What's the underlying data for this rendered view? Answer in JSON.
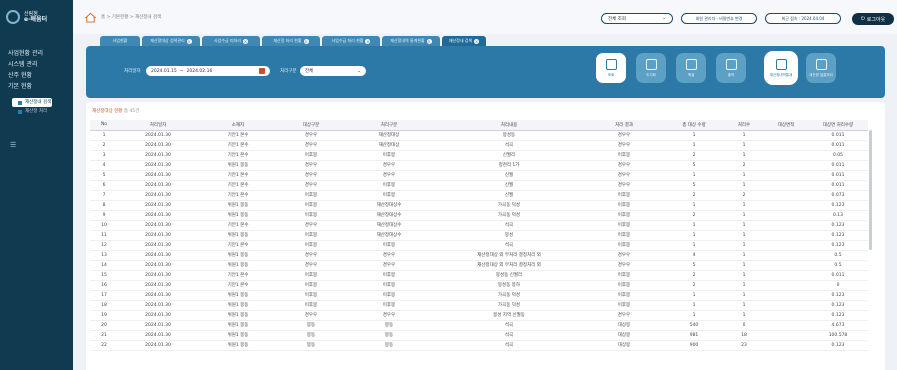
{
  "sidebar": {
    "logo_top": "산림청",
    "logo_name": "e-배움터",
    "items": [
      "사업현황 관리",
      "시스템 관리",
      "산주 현황",
      "기본 현황"
    ],
    "subitems": [
      "재산정내 검색",
      "재산정 처리"
    ]
  },
  "topbar": {
    "breadcrumb": "홈 > 기본현황 > 재산정내 검색",
    "right_label": "관리",
    "select_value": "전체 조회",
    "pill1": "회원 관리자 · 비밀번호 변경",
    "pill2": "최근 접속 : 2024.04.04",
    "logout": "로그아웃"
  },
  "tabs": [
    {
      "label": "사업현황",
      "active": false
    },
    {
      "label": "재산정대상 검색관리",
      "active": false
    },
    {
      "label": "사업수급 미처리",
      "active": false
    },
    {
      "label": "재산정 처리 현황",
      "active": false
    },
    {
      "label": "사업수급 처리 현황",
      "active": false
    },
    {
      "label": "재산정내역 통계현황",
      "active": false
    },
    {
      "label": "재산정내 검색",
      "active": true
    }
  ],
  "filters": {
    "period_label": "처리일자",
    "date_from": "2024.01.15",
    "date_to": "2024.02.16",
    "type_label": "처리구분",
    "type_value": "전체"
  },
  "buttons": [
    "조회",
    "초기화",
    "엑셀",
    "출력",
    "재산정내역통계",
    "재산정 일괄처리"
  ],
  "table": {
    "count_label": "재산정대상 현황",
    "count_value": "총 45건",
    "headers": [
      "No",
      "처리일자",
      "소재지",
      "대상구분",
      "처리구분",
      "처리내용",
      "처리 결과",
      "총 대상 수량",
      "처리수",
      "대상면적",
      "대상면 처리수량"
    ],
    "rows": [
      [
        "1",
        "2024.01.30",
        "기안1 본수",
        "경우우",
        "재산정대상",
        "봉성동",
        "경우우",
        "1",
        "1",
        "",
        "0.011"
      ],
      [
        "2",
        "2024.01.30",
        "기안1 본수",
        "경우우",
        "재산정대상",
        "석곡",
        "경우우",
        "1",
        "1",
        "",
        "0.011"
      ],
      [
        "3",
        "2024.01.30",
        "기안1 본수",
        "이후봉",
        "이후봉",
        "신월리",
        "이후봉",
        "2",
        "1",
        "",
        "0.05"
      ],
      [
        "4",
        "2024.01.30",
        "위원1 봉동",
        "경우우",
        "경우우",
        "청천리 1가",
        "경우우",
        "5",
        "2",
        "",
        "0.011"
      ],
      [
        "5",
        "2024.01.30",
        "기안1 본수",
        "경우우",
        "경우우",
        "신월",
        "경우우",
        "1",
        "1",
        "",
        "0.011"
      ],
      [
        "6",
        "2024.01.30",
        "기안1 본수",
        "경우우",
        "이후봉",
        "신월",
        "경우우",
        "5",
        "1",
        "",
        "0.011"
      ],
      [
        "7",
        "2024.01.30",
        "기안1 본수",
        "이후봉",
        "이후봉",
        "신월",
        "이후봉",
        "2",
        "2",
        "",
        "0.073"
      ],
      [
        "8",
        "2024.01.30",
        "위원1 봉동",
        "이후봉",
        "재산정대상수",
        "가곡동 덕성",
        "이후봉",
        "1",
        "1",
        "",
        "0.123"
      ],
      [
        "9",
        "2024.01.30",
        "위원1 봉동",
        "이후봉",
        "재산정대상수",
        "가곡동 덕성",
        "이후봉",
        "2",
        "1",
        "",
        "0.13"
      ],
      [
        "10",
        "2024.01.30",
        "기안1 본수",
        "경우우",
        "재산정대상수",
        "석곡",
        "이후봉",
        "1",
        "1",
        "",
        "0.123"
      ],
      [
        "11",
        "2024.01.30",
        "위원1 봉동",
        "이후봉",
        "재산정대상수",
        "봉성",
        "이후봉",
        "1",
        "1",
        "",
        "0.123"
      ],
      [
        "12",
        "2024.01.30",
        "기안1 본수",
        "이후봉",
        "이후봉",
        "석곡",
        "이후봉",
        "1",
        "1",
        "",
        "0.123"
      ],
      [
        "13",
        "2024.01.30",
        "위원1 봉동",
        "경우우",
        "경우우",
        "재산정대상 외 무처리 결정처리 외",
        "경우우",
        "4",
        "1",
        "",
        "0.5"
      ],
      [
        "14",
        "2024.01.30",
        "위원1 봉동",
        "경우우",
        "경우우",
        "재산정대상 외 무처리 결정처리 외",
        "경우우",
        "5",
        "1",
        "",
        "0.5"
      ],
      [
        "15",
        "2024.01.30",
        "기안1 본수",
        "이후봉",
        "이후봉",
        "봉성동 신월리",
        "이후봉",
        "2",
        "1",
        "",
        "0.011"
      ],
      [
        "16",
        "2024.01.30",
        "기안1 본수",
        "이후봉",
        "이후봉",
        "봉성동 봉하",
        "이후봉",
        "2",
        "1",
        "",
        "0"
      ],
      [
        "17",
        "2024.01.30",
        "위원1 봉동",
        "이후봉",
        "이후봉",
        "가곡동 덕성",
        "이후봉",
        "1",
        "1",
        "",
        "0.123"
      ],
      [
        "18",
        "2024.01.30",
        "위원1 봉동",
        "이후봉",
        "이후봉",
        "가곡동 덕성",
        "이후봉",
        "1",
        "1",
        "",
        "0.123"
      ],
      [
        "19",
        "2024.01.30",
        "위원1 봉동",
        "경우우",
        "경우우",
        "봉성 지역 신월동",
        "경우우",
        "1",
        "1",
        "",
        "0.123"
      ],
      [
        "20",
        "2024.01.30",
        "위원1 봉동",
        "봉동",
        "봉동",
        "석곡",
        "대상봉",
        "540",
        "0",
        "",
        "4.673"
      ],
      [
        "21",
        "2024.01.30",
        "위원1 봉동",
        "봉동",
        "봉동",
        "석곡",
        "대상봉",
        "981",
        "18",
        "",
        "100.578"
      ],
      [
        "22",
        "2024.01.30",
        "위원1 봉동",
        "봉동",
        "봉동",
        "석곡",
        "대상봉",
        "900",
        "23",
        "",
        "0.123"
      ]
    ]
  },
  "colors": {
    "sidebar": "#0f3a50",
    "panel": "#2c78a6",
    "accent": "#c8541f"
  }
}
